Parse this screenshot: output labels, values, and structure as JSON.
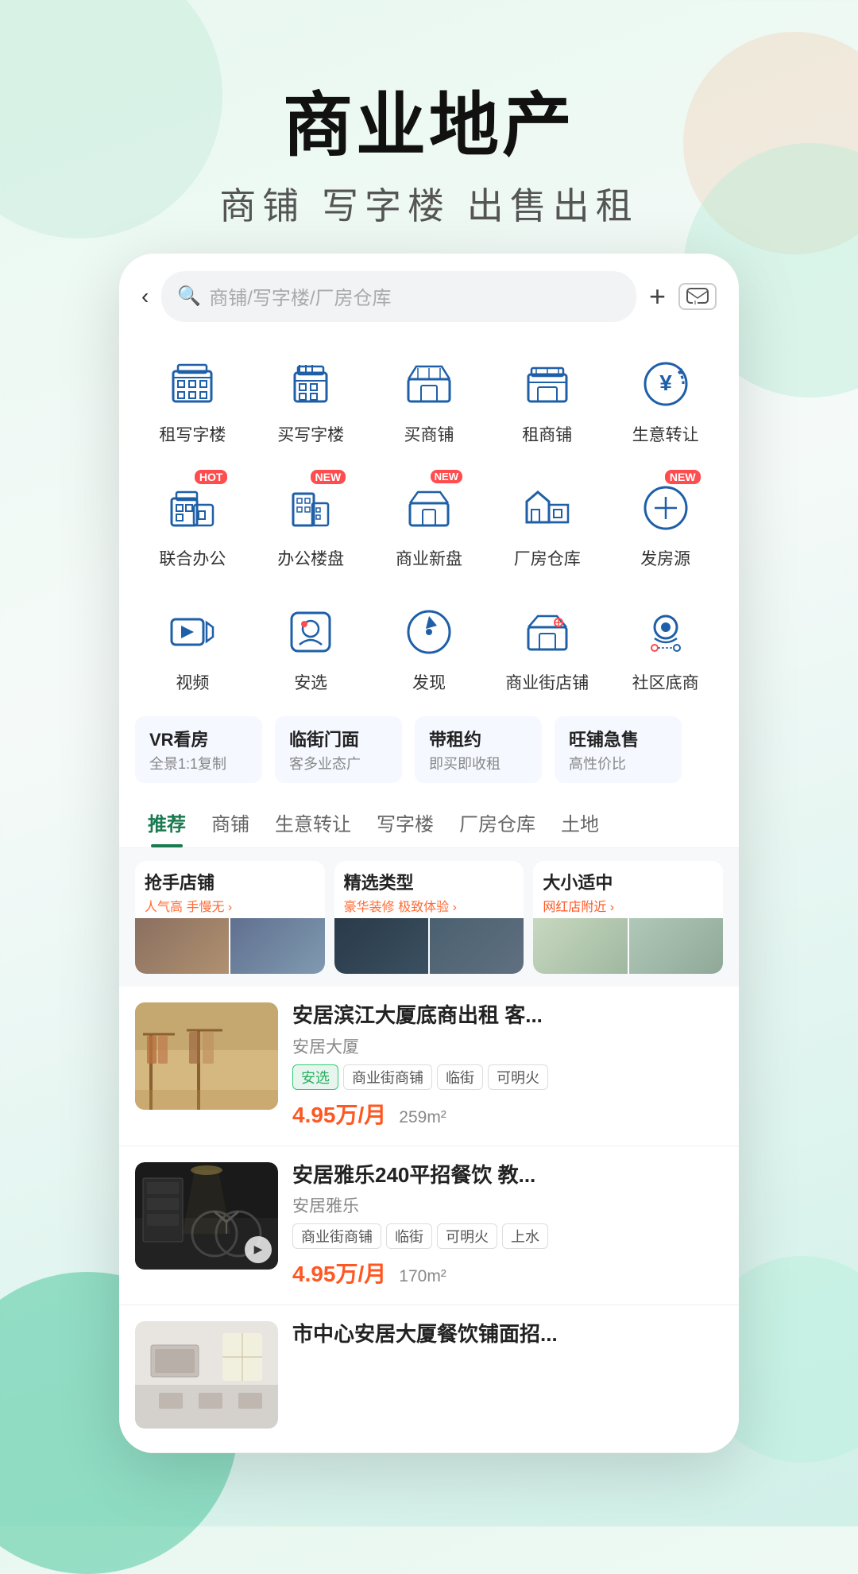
{
  "background": {
    "gradient": "linear-gradient(160deg, #e8f8f0 0%, #f5faf8 40%, #d0f0e8 100%)"
  },
  "hero": {
    "title": "商业地产",
    "subtitle": "商铺  写字楼  出售出租"
  },
  "search_bar": {
    "back_label": "‹",
    "placeholder": "商铺/写字楼/厂房仓库",
    "plus_label": "+",
    "msg_label": "□"
  },
  "icons_row1": [
    {
      "label": "租写字楼",
      "icon": "office-rent"
    },
    {
      "label": "买写字楼",
      "icon": "office-buy"
    },
    {
      "label": "买商铺",
      "icon": "shop-buy"
    },
    {
      "label": "租商铺",
      "icon": "shop-rent"
    },
    {
      "label": "生意转让",
      "icon": "business-transfer"
    }
  ],
  "icons_row2": [
    {
      "label": "联合办公",
      "icon": "cowork",
      "badge": "HOT"
    },
    {
      "label": "办公楼盘",
      "icon": "office-building",
      "badge": "NEW"
    },
    {
      "label": "商业新盘",
      "icon": "new-commercial",
      "badge": "NEW"
    },
    {
      "label": "厂房仓库",
      "icon": "factory"
    },
    {
      "label": "发房源",
      "icon": "publish",
      "badge": "NEW"
    }
  ],
  "icons_row3": [
    {
      "label": "视频",
      "icon": "video"
    },
    {
      "label": "安选",
      "icon": "an-select"
    },
    {
      "label": "发现",
      "icon": "discover"
    },
    {
      "label": "商业街店铺",
      "icon": "street-shop"
    },
    {
      "label": "社区底商",
      "icon": "community-shop"
    }
  ],
  "tags": [
    {
      "title": "VR看房",
      "sub": "全景1:1复制"
    },
    {
      "title": "临街门面",
      "sub": "客多业态广"
    },
    {
      "title": "带租约",
      "sub": "即买即收租"
    },
    {
      "title": "旺铺急售",
      "sub": "高性价比"
    }
  ],
  "tabs": [
    {
      "label": "推荐",
      "active": true
    },
    {
      "label": "商铺",
      "active": false
    },
    {
      "label": "生意转让",
      "active": false
    },
    {
      "label": "写字楼",
      "active": false
    },
    {
      "label": "厂房仓库",
      "active": false
    },
    {
      "label": "土地",
      "active": false
    }
  ],
  "feature_cards": [
    {
      "title": "抢手店铺",
      "sub": "人气高 手慢无 ›",
      "imgs": [
        "img1",
        "img2"
      ]
    },
    {
      "title": "精选类型",
      "sub": "豪华装修 极致体验 ›",
      "imgs": [
        "img3",
        "img4"
      ]
    },
    {
      "title": "大小适中",
      "sub": "网红店附近 ›",
      "imgs": [
        "img5",
        "img6"
      ]
    }
  ],
  "listings": [
    {
      "title": "安居滨江大厦底商出租 客...",
      "location": "安居大厦",
      "tags": [
        "安选",
        "商业街商铺",
        "临街",
        "可明火"
      ],
      "price": "4.95万/月",
      "area": "259m²",
      "has_video": false,
      "img_style": "shop1"
    },
    {
      "title": "安居雅乐240平招餐饮 教...",
      "location": "安居雅乐",
      "tags": [
        "商业街商铺",
        "临街",
        "可明火",
        "上水"
      ],
      "price": "4.95万/月",
      "area": "170m²",
      "has_video": true,
      "img_style": "shop2"
    },
    {
      "title": "市中心安居大厦餐饮铺面招...",
      "location": "",
      "tags": [],
      "price": "",
      "area": "",
      "has_video": false,
      "img_style": "shop3"
    }
  ],
  "colors": {
    "primary": "#1a7a50",
    "accent": "#ff5722",
    "tag_green": "#27ae60",
    "icon_blue": "#1e5fa8"
  }
}
